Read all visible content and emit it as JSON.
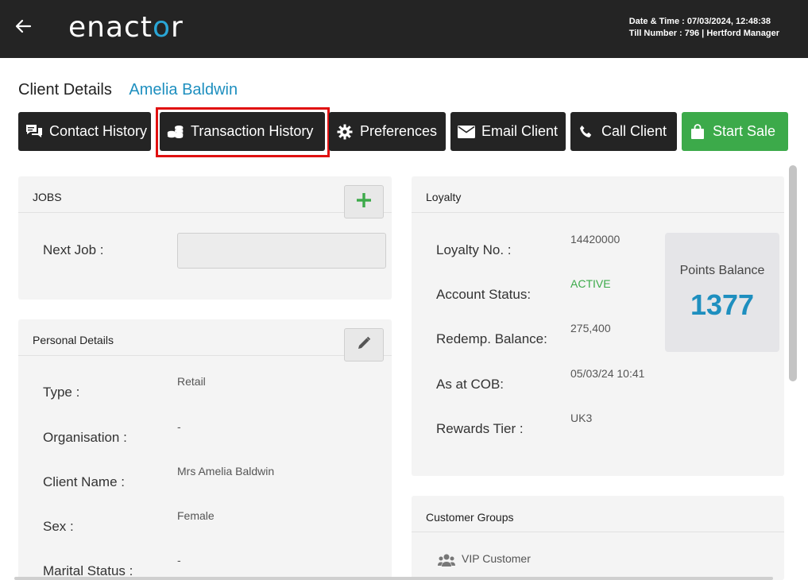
{
  "header": {
    "logo_prefix": "enact",
    "logo_o": "o",
    "logo_suffix": "r",
    "datetime_text": "Date & Time : 07/03/2024, 12:48:38",
    "till_text": "Till Number : 796  |  Hertford Manager"
  },
  "page": {
    "title_label": "Client Details",
    "client_name": "Amelia Baldwin"
  },
  "actions": {
    "contact_history": "Contact History",
    "transaction_history": "Transaction History",
    "preferences": "Preferences",
    "email_client": "Email Client",
    "call_client": "Call Client",
    "start_sale": "Start Sale"
  },
  "jobs": {
    "title": "JOBS",
    "next_job_label": "Next Job :",
    "next_job_value": ""
  },
  "personal": {
    "title": "Personal Details",
    "rows": [
      {
        "label": "Type :",
        "value": "Retail"
      },
      {
        "label": "Organisation :",
        "value": "-"
      },
      {
        "label": "Client Name :",
        "value": "Mrs Amelia Baldwin"
      },
      {
        "label": "Sex :",
        "value": "Female"
      },
      {
        "label": "Marital Status :",
        "value": "-"
      }
    ]
  },
  "loyalty": {
    "title": "Loyalty",
    "rows": [
      {
        "label": "Loyalty No. :",
        "value": "14420000"
      },
      {
        "label": "Account Status:",
        "value": "ACTIVE"
      },
      {
        "label": "Redemp. Balance:",
        "value": "275,400"
      },
      {
        "label": "As at COB:",
        "value": "05/03/24 10:41"
      },
      {
        "label": "Rewards Tier :",
        "value": "UK3"
      }
    ],
    "points_label": "Points Balance",
    "points_value": "1377",
    "active_color": "#3caa4a"
  },
  "groups": {
    "title": "Customer Groups",
    "items": [
      "VIP Customer"
    ]
  },
  "colors": {
    "accent": "#1e8fbf",
    "green": "#3caa4a",
    "highlight": "#e01010",
    "dark": "#242424"
  }
}
